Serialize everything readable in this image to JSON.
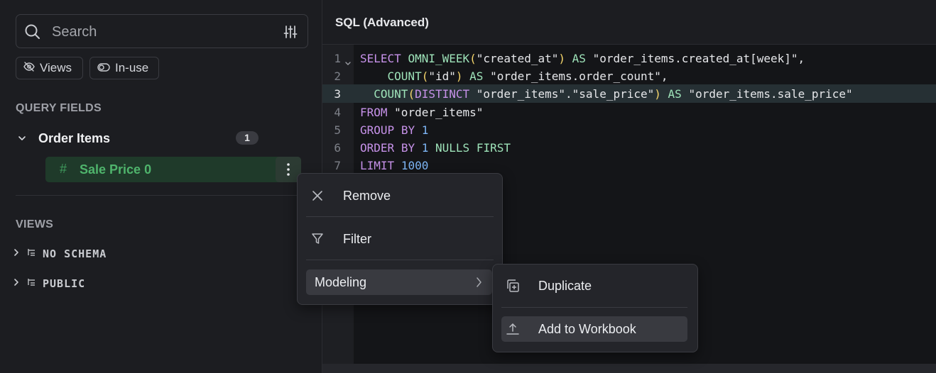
{
  "sidebar": {
    "search": {
      "placeholder": "Search"
    },
    "filter_chips": [
      {
        "label": "Views",
        "icon": "eye-off-icon"
      },
      {
        "label": "In-use",
        "icon": "toggle-icon"
      }
    ],
    "query_fields_heading": "QUERY FIELDS",
    "group": {
      "name": "Order Items",
      "count": "1"
    },
    "field": {
      "type_symbol": "#",
      "name": "Sale Price 0",
      "color": "#4fb46c"
    },
    "views_heading": "VIEWS",
    "schemas": [
      {
        "name": "NO SCHEMA"
      },
      {
        "name": "PUBLIC"
      }
    ]
  },
  "editor": {
    "title": "SQL (Advanced)",
    "active_line": 3,
    "line_numbers": [
      "1",
      "2",
      "3",
      "4",
      "5",
      "6",
      "7"
    ],
    "lines": [
      "SELECT OMNI_WEEK(\"created_at\") AS \"order_items.created_at[week]\",",
      "    COUNT(\"id\") AS \"order_items.order_count\",",
      "  COUNT(DISTINCT \"order_items\".\"sale_price\") AS \"order_items.sale_price\"",
      "FROM \"order_items\"",
      "GROUP BY 1",
      "ORDER BY 1 NULLS FIRST",
      "LIMIT 1000"
    ]
  },
  "context_menu": {
    "items": [
      {
        "label": "Remove",
        "icon": "close-icon"
      },
      {
        "label": "Filter",
        "icon": "filter-icon"
      },
      {
        "label": "Modeling",
        "icon": "chevron-right-icon"
      }
    ]
  },
  "modeling_submenu": {
    "items": [
      {
        "label": "Duplicate",
        "icon": "duplicate-icon"
      },
      {
        "label": "Add to Workbook",
        "icon": "upload-icon"
      }
    ]
  }
}
